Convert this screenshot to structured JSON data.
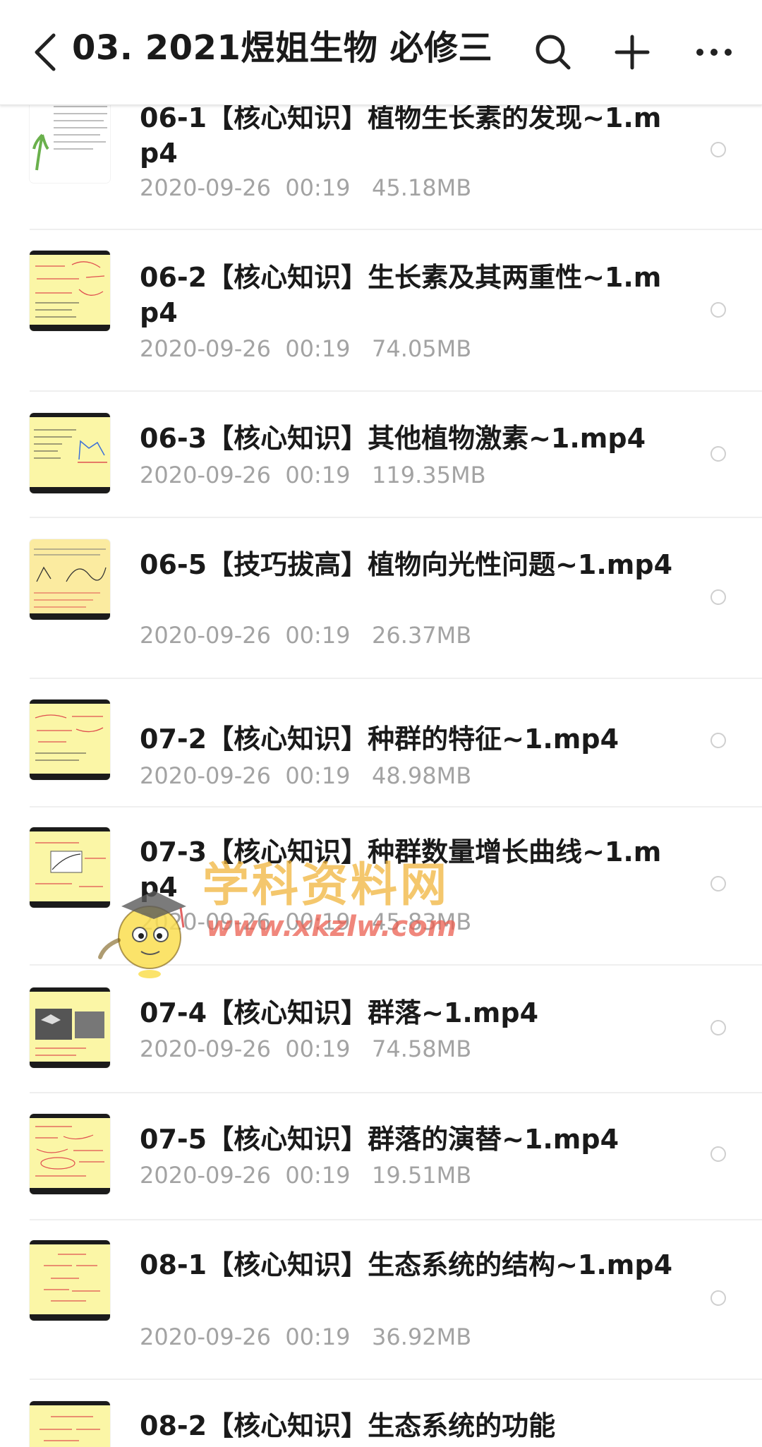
{
  "header": {
    "title": "03. 2021煜姐生物 必修三",
    "back_icon": "chevron-left-icon",
    "search_icon": "search-icon",
    "add_icon": "plus-icon",
    "more_icon": "more-dots-icon"
  },
  "files": [
    {
      "name": "06-1【核心知识】植物生长素的发现~1.mp4",
      "date": "2020-09-26",
      "time": "00:19",
      "size": "45.18MB"
    },
    {
      "name": "06-2【核心知识】生长素及其两重性~1.mp4",
      "date": "2020-09-26",
      "time": "00:19",
      "size": "74.05MB"
    },
    {
      "name": "06-3【核心知识】其他植物激素~1.mp4",
      "date": "2020-09-26",
      "time": "00:19",
      "size": "119.35MB"
    },
    {
      "name": "06-5【技巧拔高】植物向光性问题~1.mp4",
      "date": "2020-09-26",
      "time": "00:19",
      "size": "26.37MB"
    },
    {
      "name": "07-2【核心知识】种群的特征~1.mp4",
      "date": "2020-09-26",
      "time": "00:19",
      "size": "48.98MB"
    },
    {
      "name": "07-3【核心知识】种群数量增长曲线~1.mp4",
      "date": "2020-09-26",
      "time": "00:19",
      "size": "45.83MB"
    },
    {
      "name": "07-4【核心知识】群落~1.mp4",
      "date": "2020-09-26",
      "time": "00:19",
      "size": "74.58MB"
    },
    {
      "name": "07-5【核心知识】群落的演替~1.mp4",
      "date": "2020-09-26",
      "time": "00:19",
      "size": "19.51MB"
    },
    {
      "name": "08-1【核心知识】生态系统的结构~1.mp4",
      "date": "2020-09-26",
      "time": "00:19",
      "size": "36.92MB"
    },
    {
      "name": "08-2【核心知识】生态系统的功能",
      "date": "",
      "time": "",
      "size": ""
    }
  ],
  "watermark": {
    "text": "学科资料网",
    "url": "www.xkzlw.com"
  },
  "colors": {
    "thumb_bg": "#fbf6a6",
    "meta_text": "#a3a3a3",
    "title_text": "#1a1a1a"
  }
}
